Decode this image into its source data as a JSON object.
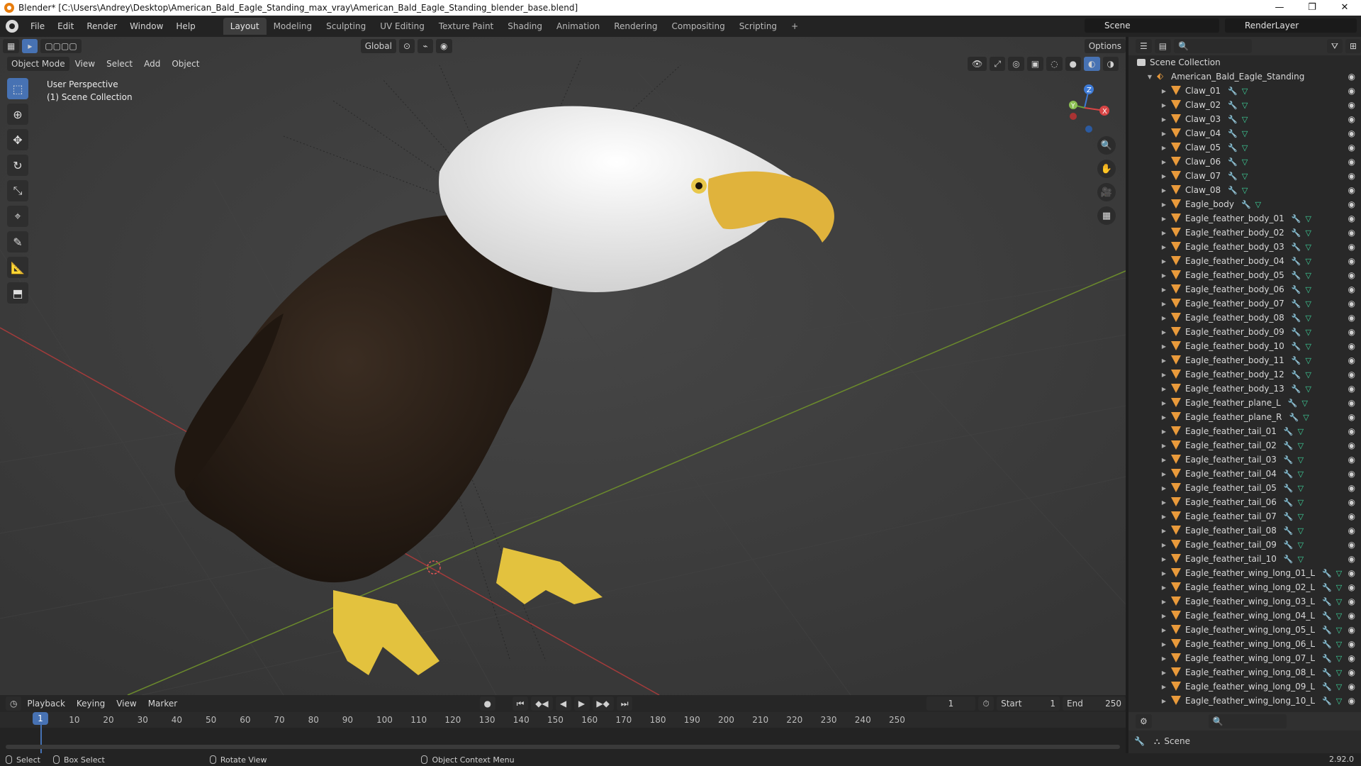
{
  "window": {
    "title": "Blender* [C:\\Users\\Andrey\\Desktop\\American_Bald_Eagle_Standing_max_vray\\American_Bald_Eagle_Standing_blender_base.blend]",
    "minimize": "—",
    "maximize": "❐",
    "close": "✕"
  },
  "menus": [
    "File",
    "Edit",
    "Render",
    "Window",
    "Help"
  ],
  "workspaces": [
    "Layout",
    "Modeling",
    "Sculpting",
    "UV Editing",
    "Texture Paint",
    "Shading",
    "Animation",
    "Rendering",
    "Compositing",
    "Scripting",
    "+"
  ],
  "scene": "Scene",
  "render_layer": "RenderLayer",
  "viewport": {
    "mode": "Object Mode",
    "menus": [
      "View",
      "Select",
      "Add",
      "Object"
    ],
    "transform": "Global",
    "options": "Options",
    "info_line1": "User Perspective",
    "info_line2": "(1) Scene Collection",
    "axis_x": "X",
    "axis_y": "Y",
    "axis_z": "Z"
  },
  "outliner": {
    "root": "Scene Collection",
    "collection": "American_Bald_Eagle_Standing",
    "items": [
      "Claw_01",
      "Claw_02",
      "Claw_03",
      "Claw_04",
      "Claw_05",
      "Claw_06",
      "Claw_07",
      "Claw_08",
      "Eagle_body",
      "Eagle_feather_body_01",
      "Eagle_feather_body_02",
      "Eagle_feather_body_03",
      "Eagle_feather_body_04",
      "Eagle_feather_body_05",
      "Eagle_feather_body_06",
      "Eagle_feather_body_07",
      "Eagle_feather_body_08",
      "Eagle_feather_body_09",
      "Eagle_feather_body_10",
      "Eagle_feather_body_11",
      "Eagle_feather_body_12",
      "Eagle_feather_body_13",
      "Eagle_feather_plane_L",
      "Eagle_feather_plane_R",
      "Eagle_feather_tail_01",
      "Eagle_feather_tail_02",
      "Eagle_feather_tail_03",
      "Eagle_feather_tail_04",
      "Eagle_feather_tail_05",
      "Eagle_feather_tail_06",
      "Eagle_feather_tail_07",
      "Eagle_feather_tail_08",
      "Eagle_feather_tail_09",
      "Eagle_feather_tail_10",
      "Eagle_feather_wing_long_01_L",
      "Eagle_feather_wing_long_02_L",
      "Eagle_feather_wing_long_03_L",
      "Eagle_feather_wing_long_04_L",
      "Eagle_feather_wing_long_05_L",
      "Eagle_feather_wing_long_06_L",
      "Eagle_feather_wing_long_07_L",
      "Eagle_feather_wing_long_08_L",
      "Eagle_feather_wing_long_09_L",
      "Eagle_feather_wing_long_10_L"
    ]
  },
  "properties": {
    "scene": "Scene"
  },
  "timeline": {
    "menus": [
      "Playback",
      "Keying",
      "View",
      "Marker"
    ],
    "current_frame": "1",
    "start_label": "Start",
    "start": "1",
    "end_label": "End",
    "end": "250",
    "ruler": [
      "10",
      "20",
      "30",
      "40",
      "50",
      "60",
      "70",
      "80",
      "90",
      "100",
      "110",
      "120",
      "130",
      "140",
      "150",
      "160",
      "170",
      "180",
      "190",
      "200",
      "210",
      "220",
      "230",
      "240",
      "250"
    ],
    "cursor": "1"
  },
  "status": {
    "select": "Select",
    "box_select": "Box Select",
    "rotate": "Rotate View",
    "context": "Object Context Menu",
    "version": "2.92.0"
  },
  "colors": {
    "accent": "#4772b3",
    "object_icon": "#e99a3b",
    "mesh_icon": "#3ed39b",
    "modifier_icon": "#7aa7ff"
  }
}
